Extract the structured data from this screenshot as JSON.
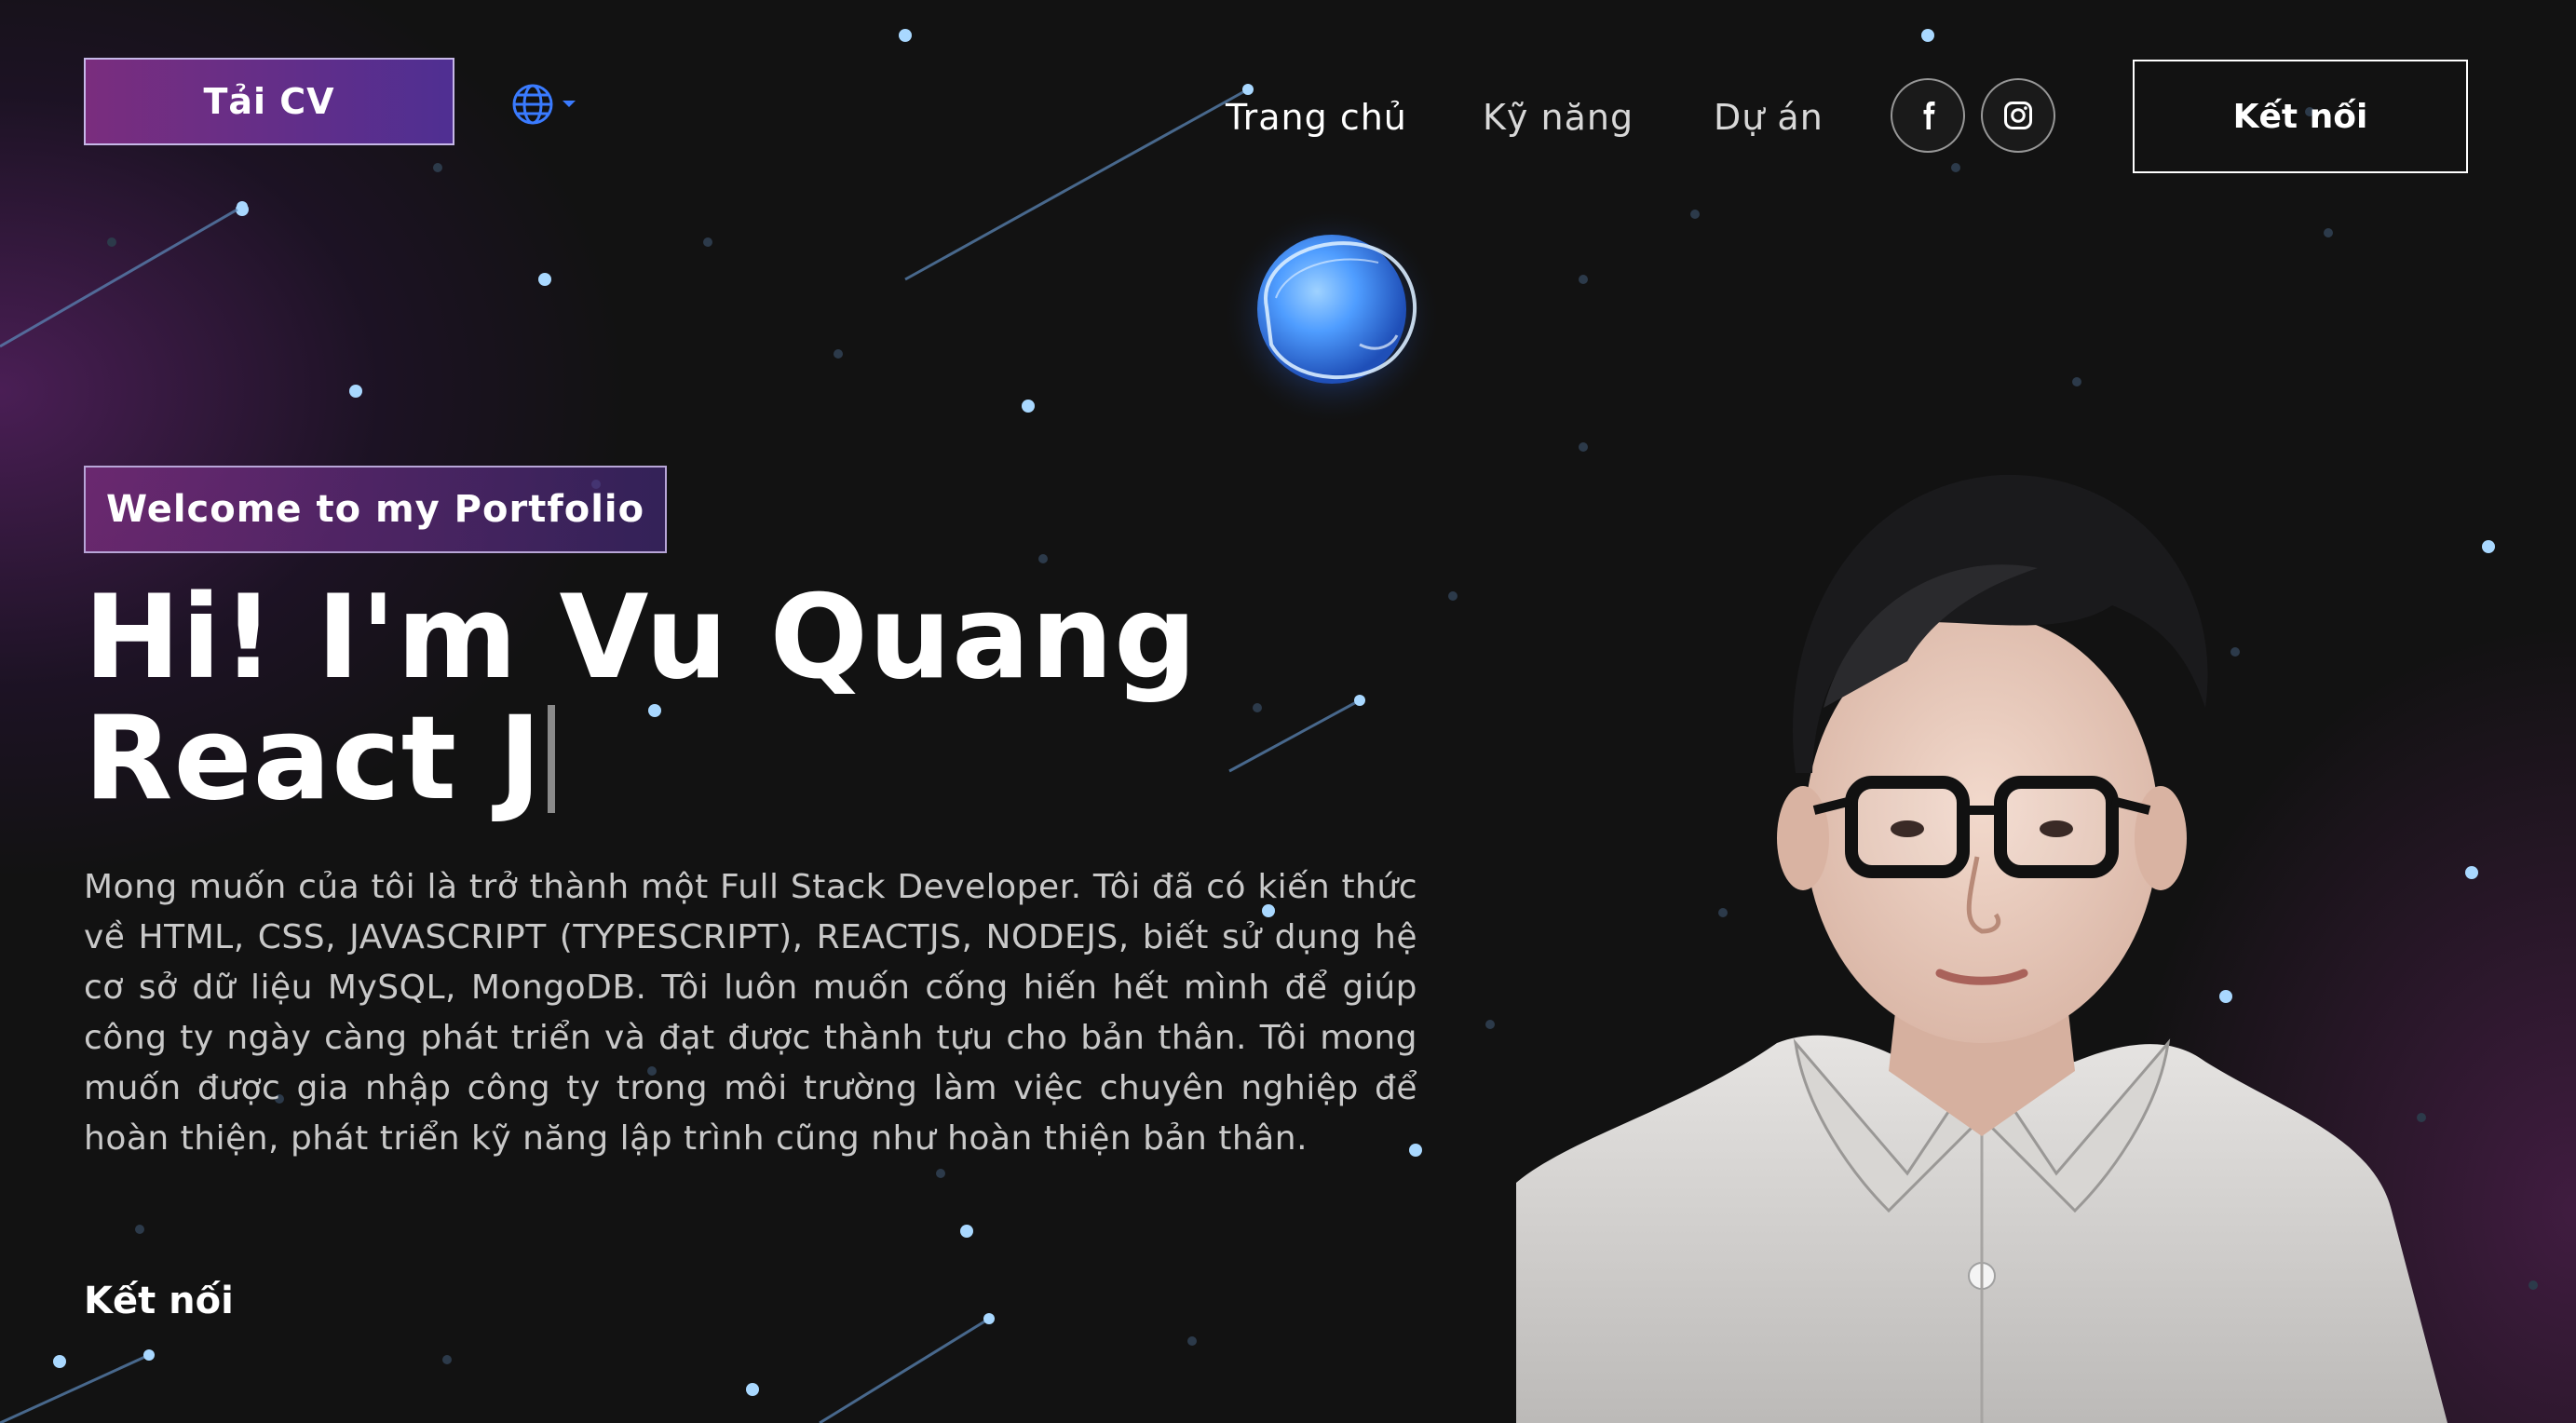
{
  "header": {
    "cv_label": "Tải CV",
    "nav": [
      {
        "label": "Trang chủ"
      },
      {
        "label": "Kỹ năng"
      },
      {
        "label": "Dự án"
      }
    ],
    "social": [
      {
        "icon": "facebook-icon"
      },
      {
        "icon": "instagram-icon"
      }
    ],
    "connect_label": "Kết nối",
    "language_icon": "globe-icon"
  },
  "hero": {
    "tagline": "Welcome to my Portfolio",
    "headline_line1": "Hi! I'm Vu Quang",
    "headline_line2": "React J",
    "bio": "Mong muốn của tôi là trở thành một Full Stack Developer. Tôi đã có kiến thức về HTML, CSS, JAVASCRIPT (TYPESCRIPT), REACTJS, NODEJS, biết sử dụng hệ cơ sở dữ liệu MySQL, MongoDB. Tôi luôn muốn cống hiến hết mình để giúp công ty ngày càng phát triển và đạt được thành tựu cho bản thân. Tôi mong muốn được gia nhập công ty trong môi trường làm việc chuyên nghiệp để hoàn thiện, phát triển kỹ năng lập trình cũng như hoàn thiện bản thân.",
    "connect_label": "Kết nối"
  },
  "colors": {
    "background": "#121212",
    "accent_purple": "#7a2d7e",
    "accent_indigo": "#4f2f92",
    "star": "#a9d8ff",
    "planet": "#4f9dff"
  }
}
